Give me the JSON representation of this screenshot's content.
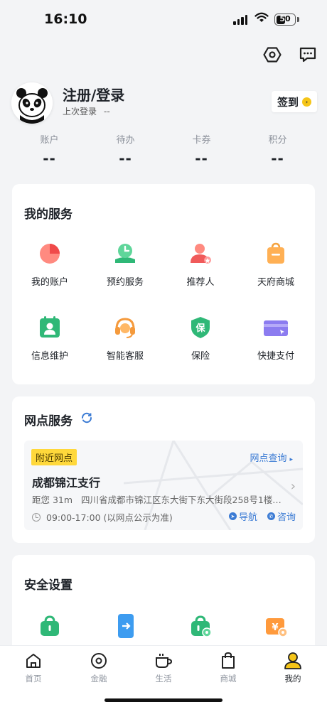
{
  "status": {
    "time": "16:10",
    "battery": "50",
    "battery_level": 0.5
  },
  "top_icons": [
    "settings-hexagon-icon",
    "message-icon"
  ],
  "profile": {
    "title": "注册/登录",
    "last_login_label": "上次登录",
    "last_login_value": "--",
    "signin_label": "签到"
  },
  "stats": [
    {
      "label": "账户",
      "value": "--"
    },
    {
      "label": "待办",
      "value": "--"
    },
    {
      "label": "卡券",
      "value": "--"
    },
    {
      "label": "积分",
      "value": "--"
    }
  ],
  "services": {
    "title": "我的服务",
    "items": [
      {
        "label": "我的账户",
        "icon": "pie-chart-icon"
      },
      {
        "label": "预约服务",
        "icon": "appointment-clock-icon"
      },
      {
        "label": "推荐人",
        "icon": "referrer-person-icon"
      },
      {
        "label": "天府商城",
        "icon": "shopping-bag-icon"
      },
      {
        "label": "信息维护",
        "icon": "id-card-icon"
      },
      {
        "label": "智能客服",
        "icon": "headset-icon"
      },
      {
        "label": "保险",
        "icon": "insurance-shield-icon"
      },
      {
        "label": "快捷支付",
        "icon": "quick-pay-card-icon"
      }
    ]
  },
  "branch": {
    "title": "网点服务",
    "tag": "附近网点",
    "query_label": "网点查询",
    "name": "成都锦江支行",
    "distance": "距您 31m",
    "address": "四川省成都市锦江区东大街下东大街段258号1楼、…",
    "hours": "09:00-17:00 (以网点公示为准)",
    "nav_label": "导航",
    "consult_label": "咨询"
  },
  "security": {
    "title": "安全设置",
    "icons": [
      "lock-bag-icon",
      "phone-transfer-icon",
      "lock-settings-icon",
      "yuan-wallet-icon"
    ]
  },
  "tabs": [
    {
      "label": "首页",
      "icon": "home-icon"
    },
    {
      "label": "金融",
      "icon": "finance-circle-icon"
    },
    {
      "label": "生活",
      "icon": "coffee-cup-icon"
    },
    {
      "label": "商城",
      "icon": "shop-bag-icon"
    },
    {
      "label": "我的",
      "icon": "profile-person-icon",
      "active": true
    }
  ],
  "colors": {
    "accent_blue": "#3b7bd4",
    "tag_yellow": "#ffd83b",
    "active_tab": "#f5c518"
  }
}
